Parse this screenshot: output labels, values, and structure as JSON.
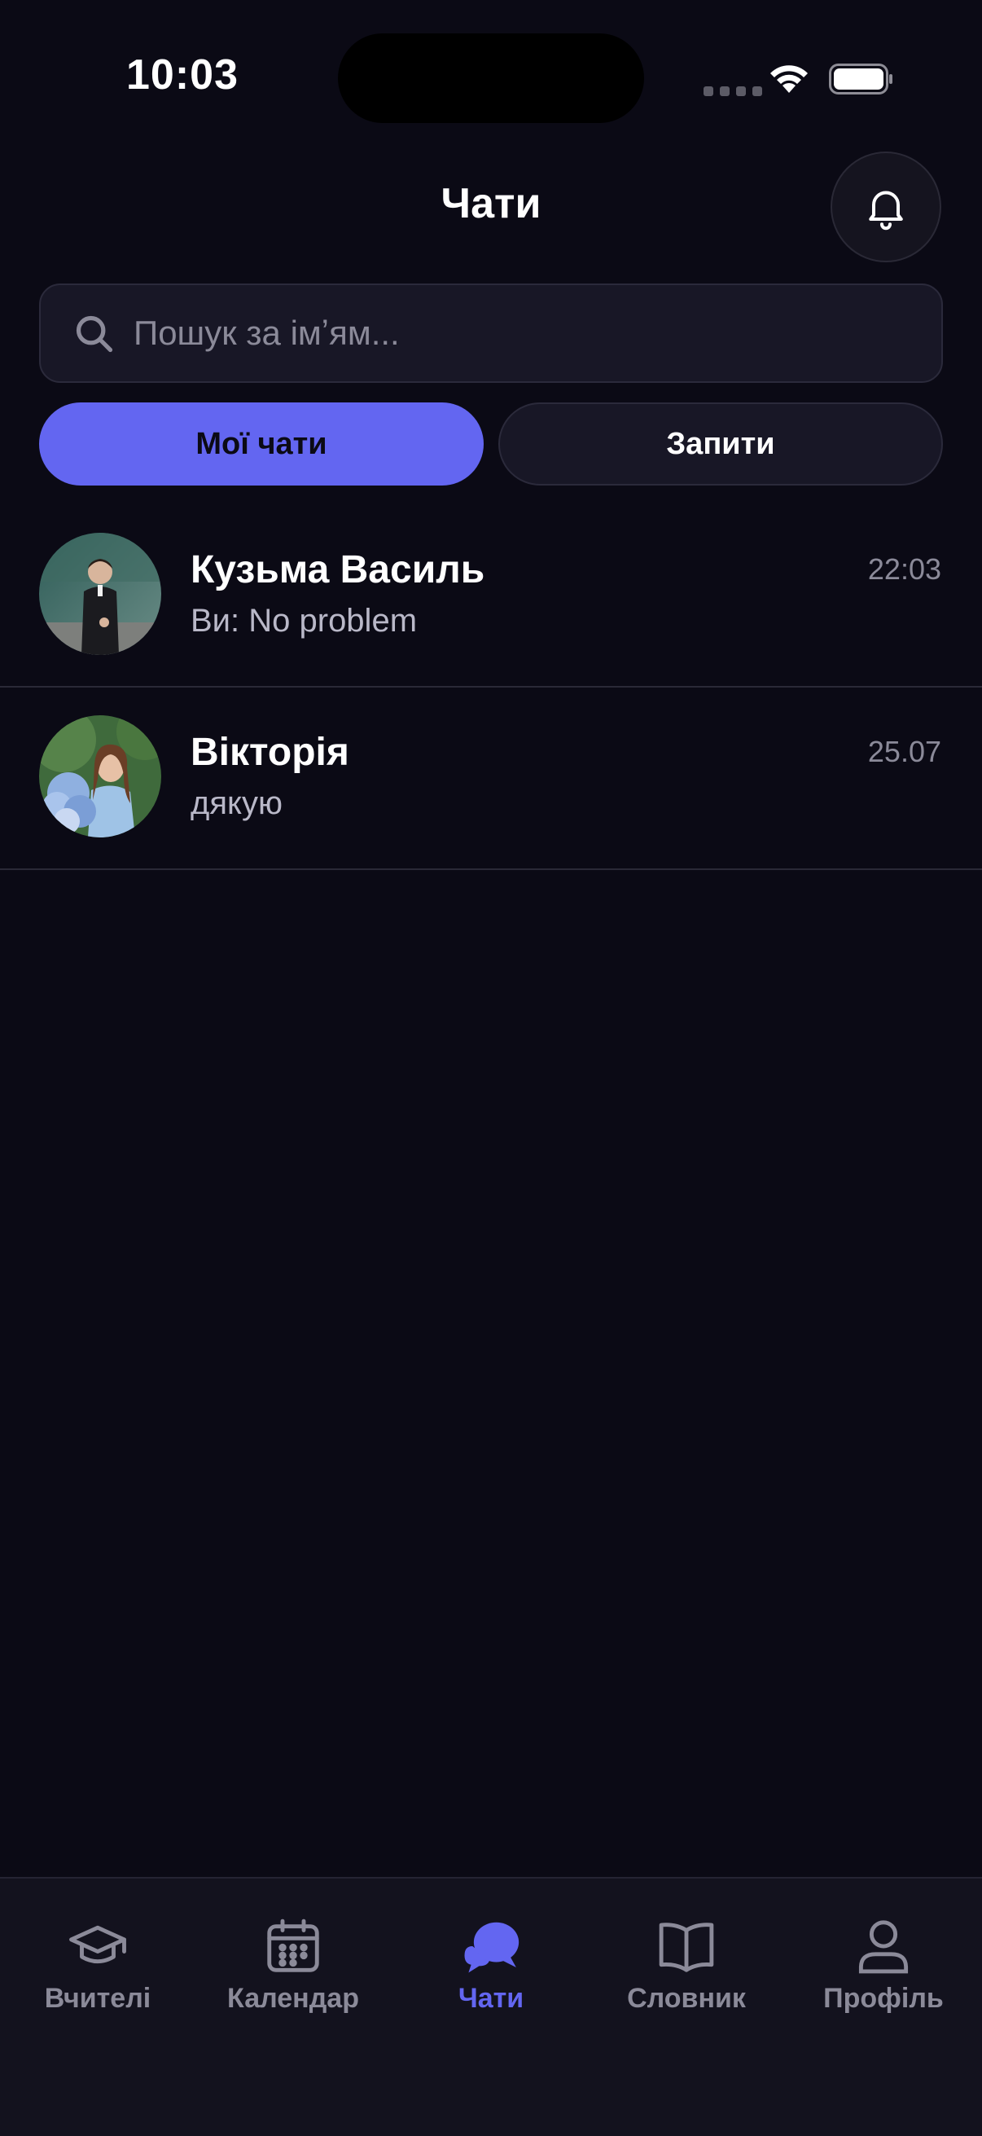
{
  "status_bar": {
    "time": "10:03"
  },
  "header": {
    "title": "Чати",
    "bell_icon": "bell-icon"
  },
  "search": {
    "placeholder": "Пошук за імʼям...",
    "value": "",
    "icon": "search-icon"
  },
  "segments": {
    "my_chats": "Мої чати",
    "requests": "Запити",
    "selected": "my_chats"
  },
  "chats": [
    {
      "name": "Кузьма Василь",
      "preview": "Ви: No problem",
      "time": "22:03",
      "avatar": "avatar-photo"
    },
    {
      "name": "Вікторія",
      "preview": "дякую",
      "time": "25.07",
      "avatar": "avatar-photo"
    }
  ],
  "tab_bar": {
    "items": [
      {
        "label": "Вчителі",
        "icon": "graduation-cap-icon"
      },
      {
        "label": "Календар",
        "icon": "calendar-icon"
      },
      {
        "label": "Чати",
        "icon": "chat-bubbles-icon"
      },
      {
        "label": "Словник",
        "icon": "book-icon"
      },
      {
        "label": "Профіль",
        "icon": "user-icon"
      }
    ],
    "active": "Чати"
  },
  "colors": {
    "background": "#0b0a15",
    "accent": "#6366f1",
    "surface": "#181726",
    "muted_text": "#8b8a99"
  }
}
